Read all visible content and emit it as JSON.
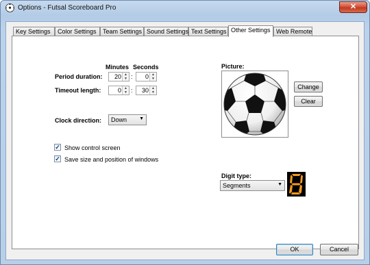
{
  "window": {
    "title": "Options - Futsal Scoreboard Pro",
    "close_label": "✕"
  },
  "tabs": [
    {
      "label": "Key Settings",
      "active": false
    },
    {
      "label": "Color Settings",
      "active": false
    },
    {
      "label": "Team Settings",
      "active": false
    },
    {
      "label": "Sound Settings",
      "active": false
    },
    {
      "label": "Text Settings",
      "active": false
    },
    {
      "label": "Other Settings",
      "active": true
    },
    {
      "label": "Web Remote",
      "active": false
    }
  ],
  "timing": {
    "minutes_header": "Minutes",
    "seconds_header": "Seconds",
    "separator": ":",
    "period_label": "Period duration:",
    "period_minutes": "20",
    "period_seconds": "0",
    "timeout_label": "Timeout length:",
    "timeout_minutes": "0",
    "timeout_seconds": "30"
  },
  "clock": {
    "label": "Clock direction:",
    "value": "Down"
  },
  "options": {
    "show_control_screen": {
      "label": "Show control screen",
      "checked": true
    },
    "save_windows": {
      "label": "Save size and position of windows",
      "checked": true
    }
  },
  "picture": {
    "label": "Picture:",
    "change_label": "Change",
    "clear_label": "Clear"
  },
  "digit_type": {
    "label": "Digit type:",
    "value": "Segments",
    "preview_digit": "8",
    "segment_color": "#f59a1d"
  },
  "footer": {
    "ok_label": "OK",
    "cancel_label": "Cancel"
  }
}
